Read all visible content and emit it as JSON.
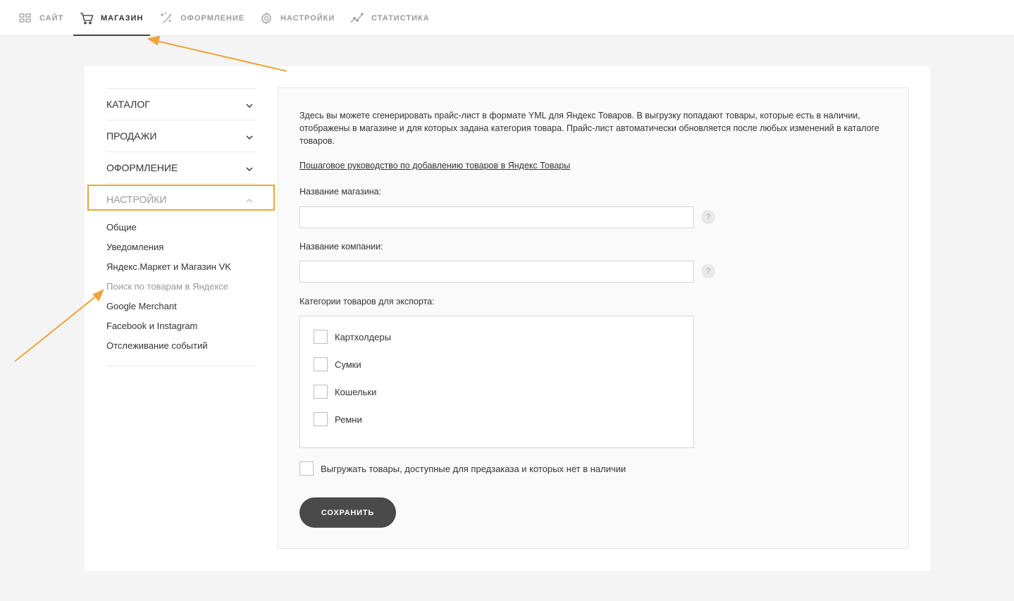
{
  "nav": {
    "items": [
      {
        "label": "САЙТ",
        "icon": "grid-icon"
      },
      {
        "label": "МАГАЗИН",
        "icon": "cart-icon"
      },
      {
        "label": "ОФОРМЛЕНИЕ",
        "icon": "magic-wand-icon"
      },
      {
        "label": "НАСТРОЙКИ",
        "icon": "gear-icon"
      },
      {
        "label": "СТАТИСТИКА",
        "icon": "chart-line-icon"
      }
    ],
    "active": "МАГАЗИН"
  },
  "sidebar": {
    "sections": [
      {
        "label": "КАТАЛОГ"
      },
      {
        "label": "ПРОДАЖИ"
      },
      {
        "label": "ОФОРМЛЕНИЕ"
      },
      {
        "label": "НАСТРОЙКИ"
      }
    ],
    "settings_items": [
      {
        "label": "Общие"
      },
      {
        "label": "Уведомления"
      },
      {
        "label": "Яндекс.Маркет и Магазин VK"
      },
      {
        "label": "Поиск по товарам в Яндексе"
      },
      {
        "label": "Google Merchant"
      },
      {
        "label": "Facebook и Instagram"
      },
      {
        "label": "Отслеживание событий"
      }
    ],
    "current_item": "Поиск по товарам в Яндексе"
  },
  "content": {
    "intro": "Здесь вы можете сгенерировать прайс-лист в формате YML для Яндекс Товаров. В выгрузку попадают товары, которые есть в наличии, отображены в магазине и для которых задана категория товара. Прайс-лист автоматически обновляется после любых изменений в каталоге товаров.",
    "guide_link": "Пошаговое руководство по добавлению товаров в Яндекс Товары",
    "shop_name_label": "Название магазина:",
    "shop_name_value": "",
    "company_label": "Название компании:",
    "company_value": "",
    "help_glyph": "?",
    "categories_label": "Категории товаров для экспорта:",
    "categories": [
      {
        "label": "Картхолдеры",
        "checked": false
      },
      {
        "label": "Сумки",
        "checked": false
      },
      {
        "label": "Кошельки",
        "checked": false
      },
      {
        "label": "Ремни",
        "checked": false
      }
    ],
    "preorder_label": "Выгружать товары, доступные для предзаказа и которых нет в наличии",
    "save_button": "СОХРАНИТЬ"
  },
  "colors": {
    "annotation": "#f0a33c",
    "button": "#4a4a4a",
    "background": "#f4f4f4"
  }
}
